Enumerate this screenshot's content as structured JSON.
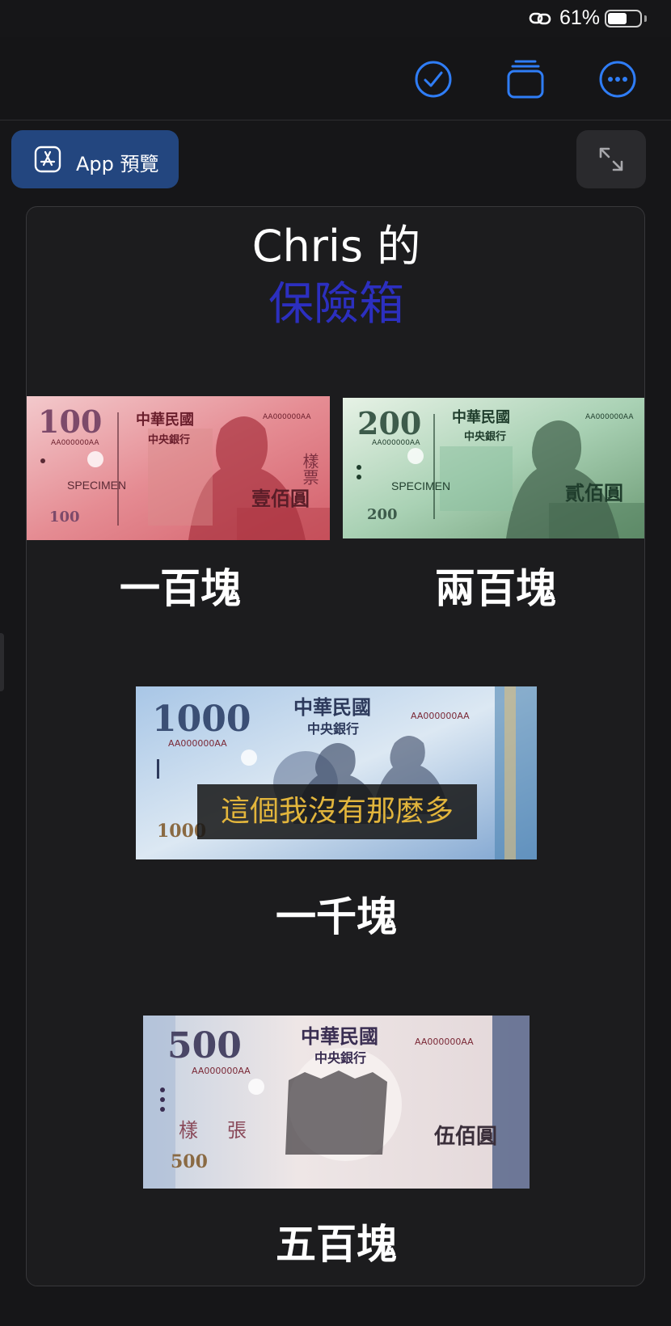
{
  "status_bar": {
    "battery_percent": "61%",
    "battery_level": 0.61,
    "link_icon": "link-icon"
  },
  "toolbar": {
    "done_icon": "checkmark-circle-icon",
    "windows_icon": "stacked-windows-icon",
    "more_icon": "ellipsis-circle-icon",
    "accent_color": "#2f7df6"
  },
  "preview_button": {
    "label": "App 預覽",
    "icon": "app-store-icon",
    "color": "#23467f"
  },
  "expand_button": {
    "icon": "expand-arrows-icon"
  },
  "card": {
    "title_line1": "Chris 的",
    "title_line2": "保險箱",
    "title_line2_color": "#2c2fbf",
    "notes": [
      {
        "id": "100",
        "caption": "一百塊",
        "denomination": "100",
        "country": "中華民國",
        "bank": "中央銀行",
        "serial": "AA000000AA",
        "specimen": "SPECIMEN",
        "amount_text": "壹佰圓",
        "stamp": "樣票",
        "color": "#d8707a"
      },
      {
        "id": "200",
        "caption": "兩百塊",
        "denomination": "200",
        "country": "中華民國",
        "bank": "中央銀行",
        "serial": "AA000000AA",
        "specimen": "SPECIMEN",
        "amount_text": "貳佰圓",
        "color": "#7fb48e"
      },
      {
        "id": "1000",
        "caption": "一千塊",
        "denomination": "1000",
        "country": "中華民國",
        "bank": "中央銀行",
        "serial": "AA000000AA",
        "overlay_text": "這個我沒有那麼多",
        "color": "#8fb0d8"
      },
      {
        "id": "500",
        "caption": "五百塊",
        "denomination": "500",
        "country": "中華民國",
        "bank": "中央銀行",
        "serial": "AA000000AA",
        "amount_text": "伍佰圓",
        "stamp_left": "樣",
        "stamp_right": "張",
        "color": "#b59a9e"
      }
    ]
  }
}
